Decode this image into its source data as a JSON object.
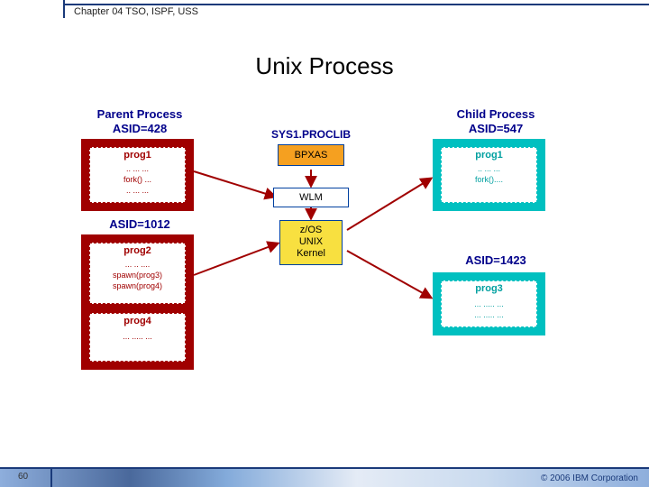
{
  "header": {
    "chapter": "Chapter 04 TSO, ISPF, USS"
  },
  "title": "Unix Process",
  "labels": {
    "parent": "Parent Process",
    "child": "Child Process",
    "asid_parent": "ASID=428",
    "asid_parent2": "ASID=1012",
    "asid_child1": "ASID=547",
    "asid_child2": "ASID=1423",
    "sys_proclib": "SYS1.PROCLIB"
  },
  "parent": {
    "box1": {
      "title": "prog1",
      "line1": ".. ... ...",
      "line2": "fork() ...",
      "line3": ".. ... ..."
    },
    "box2": {
      "title": "prog2",
      "line1": "... .. ....",
      "line2": "spawn(prog3)",
      "line3": "spawn(prog4)",
      "sub_title": "prog4",
      "sub_line": "... ..... ..."
    }
  },
  "system": {
    "bpxas": "BPXAS",
    "wlm": "WLM",
    "kernel": "z/OS\nUNIX\nKernel"
  },
  "child": {
    "box1": {
      "title": "prog1",
      "line1": ".. ... ...",
      "line2": "fork()....",
      "line3": ""
    },
    "box2": {
      "title": "prog3",
      "line1": "... ..... ...",
      "line2": "... ..... ..."
    }
  },
  "footer": {
    "page": "60",
    "copyright": "© 2006 IBM Corporation"
  }
}
